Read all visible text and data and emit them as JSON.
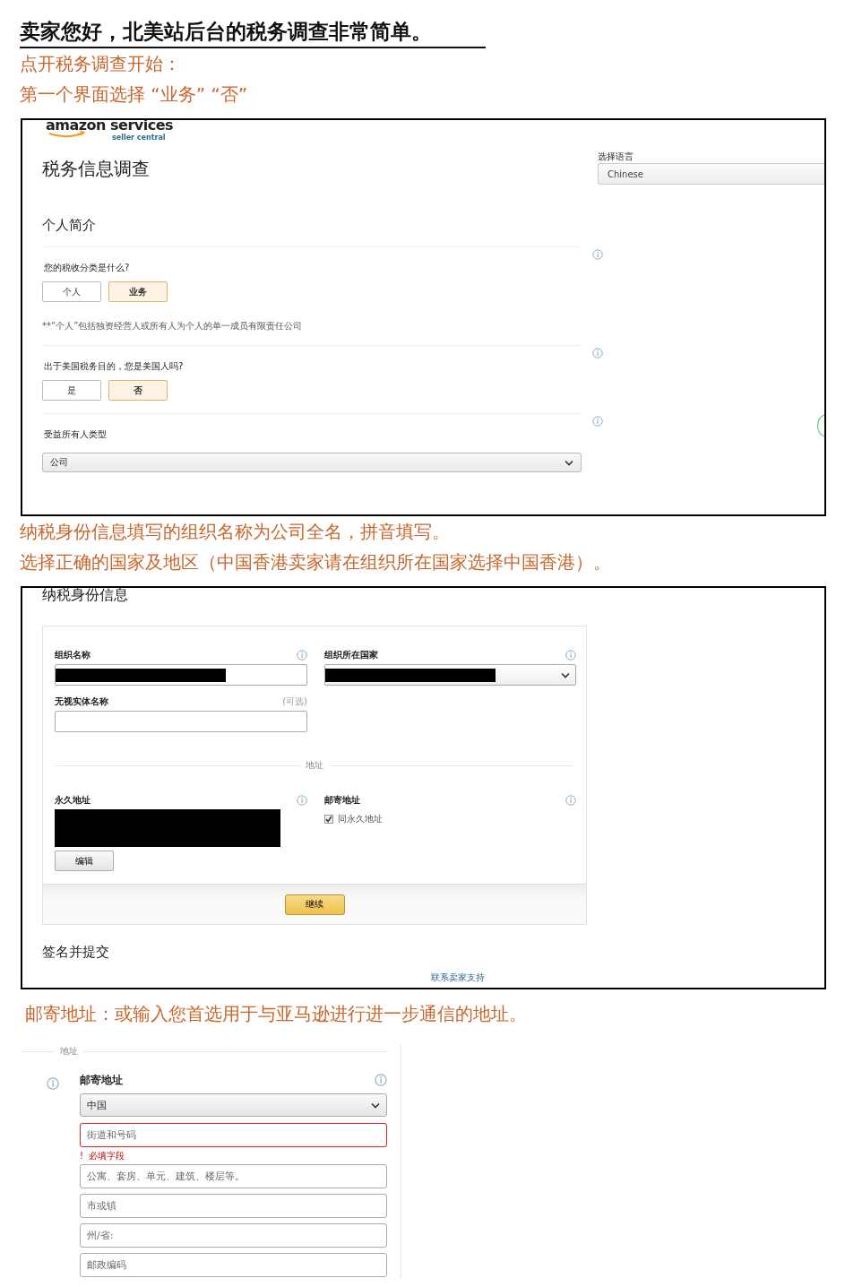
{
  "article": {
    "title": "卖家您好，北美站后台的税务调查非常简单。"
  },
  "step_1": {
    "notes": [
      "点开税务调查开始：",
      "第一个界面选择 “业务”  “否”"
    ]
  },
  "screenshot_1": {
    "logo": {
      "brand": "amazon services",
      "tagline": "seller central"
    },
    "page_title": "税务信息调查",
    "language": {
      "label": "选择语言",
      "value": "Chinese"
    },
    "section_title": "个人简介",
    "questions": [
      {
        "kind": "choice",
        "label": "您的税收分类是什么?",
        "options": [
          {
            "label": "个人",
            "selected": false
          },
          {
            "label": "业务",
            "selected": true
          }
        ],
        "footnote": "**“个人”包括独资经营人或所有人为个人的单一成员有限责任公司"
      },
      {
        "kind": "choice",
        "label": "出于美国税务目的，您是美国人吗?",
        "options": [
          {
            "label": "是",
            "selected": false
          },
          {
            "label": "否",
            "selected": true
          }
        ]
      },
      {
        "kind": "select",
        "label": "受益所有人类型",
        "value": "公司"
      }
    ]
  },
  "step_2": {
    "notes": [
      "纳税身份信息填写的组织名称为公司全名，拼音填写。",
      "选择正确的国家及地区（中国香港卖家请在组织所在国家选择中国香港）。"
    ]
  },
  "screenshot_2": {
    "section_title": "纳税身份信息",
    "fields": [
      {
        "kind": "input",
        "label": "组织名称",
        "redacted": true
      },
      {
        "kind": "select",
        "label": "组织所在国家",
        "redacted": true
      },
      {
        "kind": "input",
        "label": "无视实体名称",
        "optional": "(可选)",
        "redacted": false
      }
    ],
    "address_divider": "地址",
    "permanent_address": {
      "label": "永久地址",
      "redacted": true,
      "edit_button": "编辑"
    },
    "mailing_address": {
      "label": "邮寄地址",
      "same_as_permanent": {
        "label": "同永久地址",
        "checked": true
      }
    },
    "continue_button": "继续",
    "next_section": "签名并提交",
    "support_link": "联系卖家支持"
  },
  "step_3": {
    "notes": [
      "邮寄地址：或输入您首选用于与亚马逊进行进一步通信的地址。"
    ]
  },
  "screenshot_3": {
    "divider": "地址",
    "label": "邮寄地址",
    "fields": [
      {
        "kind": "select",
        "value": "中国"
      },
      {
        "kind": "input",
        "placeholder": "街道和号码",
        "invalid": true,
        "error": {
          "mark": "!",
          "text": "必填字段"
        }
      },
      {
        "kind": "input",
        "placeholder": "公寓、套房、单元、建筑、楼层等。",
        "invalid": false
      },
      {
        "kind": "input",
        "placeholder": "市或镇",
        "invalid": false
      },
      {
        "kind": "input",
        "placeholder": "州/省:",
        "invalid": false
      },
      {
        "kind": "input",
        "placeholder": "邮政编码",
        "invalid": false
      }
    ]
  }
}
